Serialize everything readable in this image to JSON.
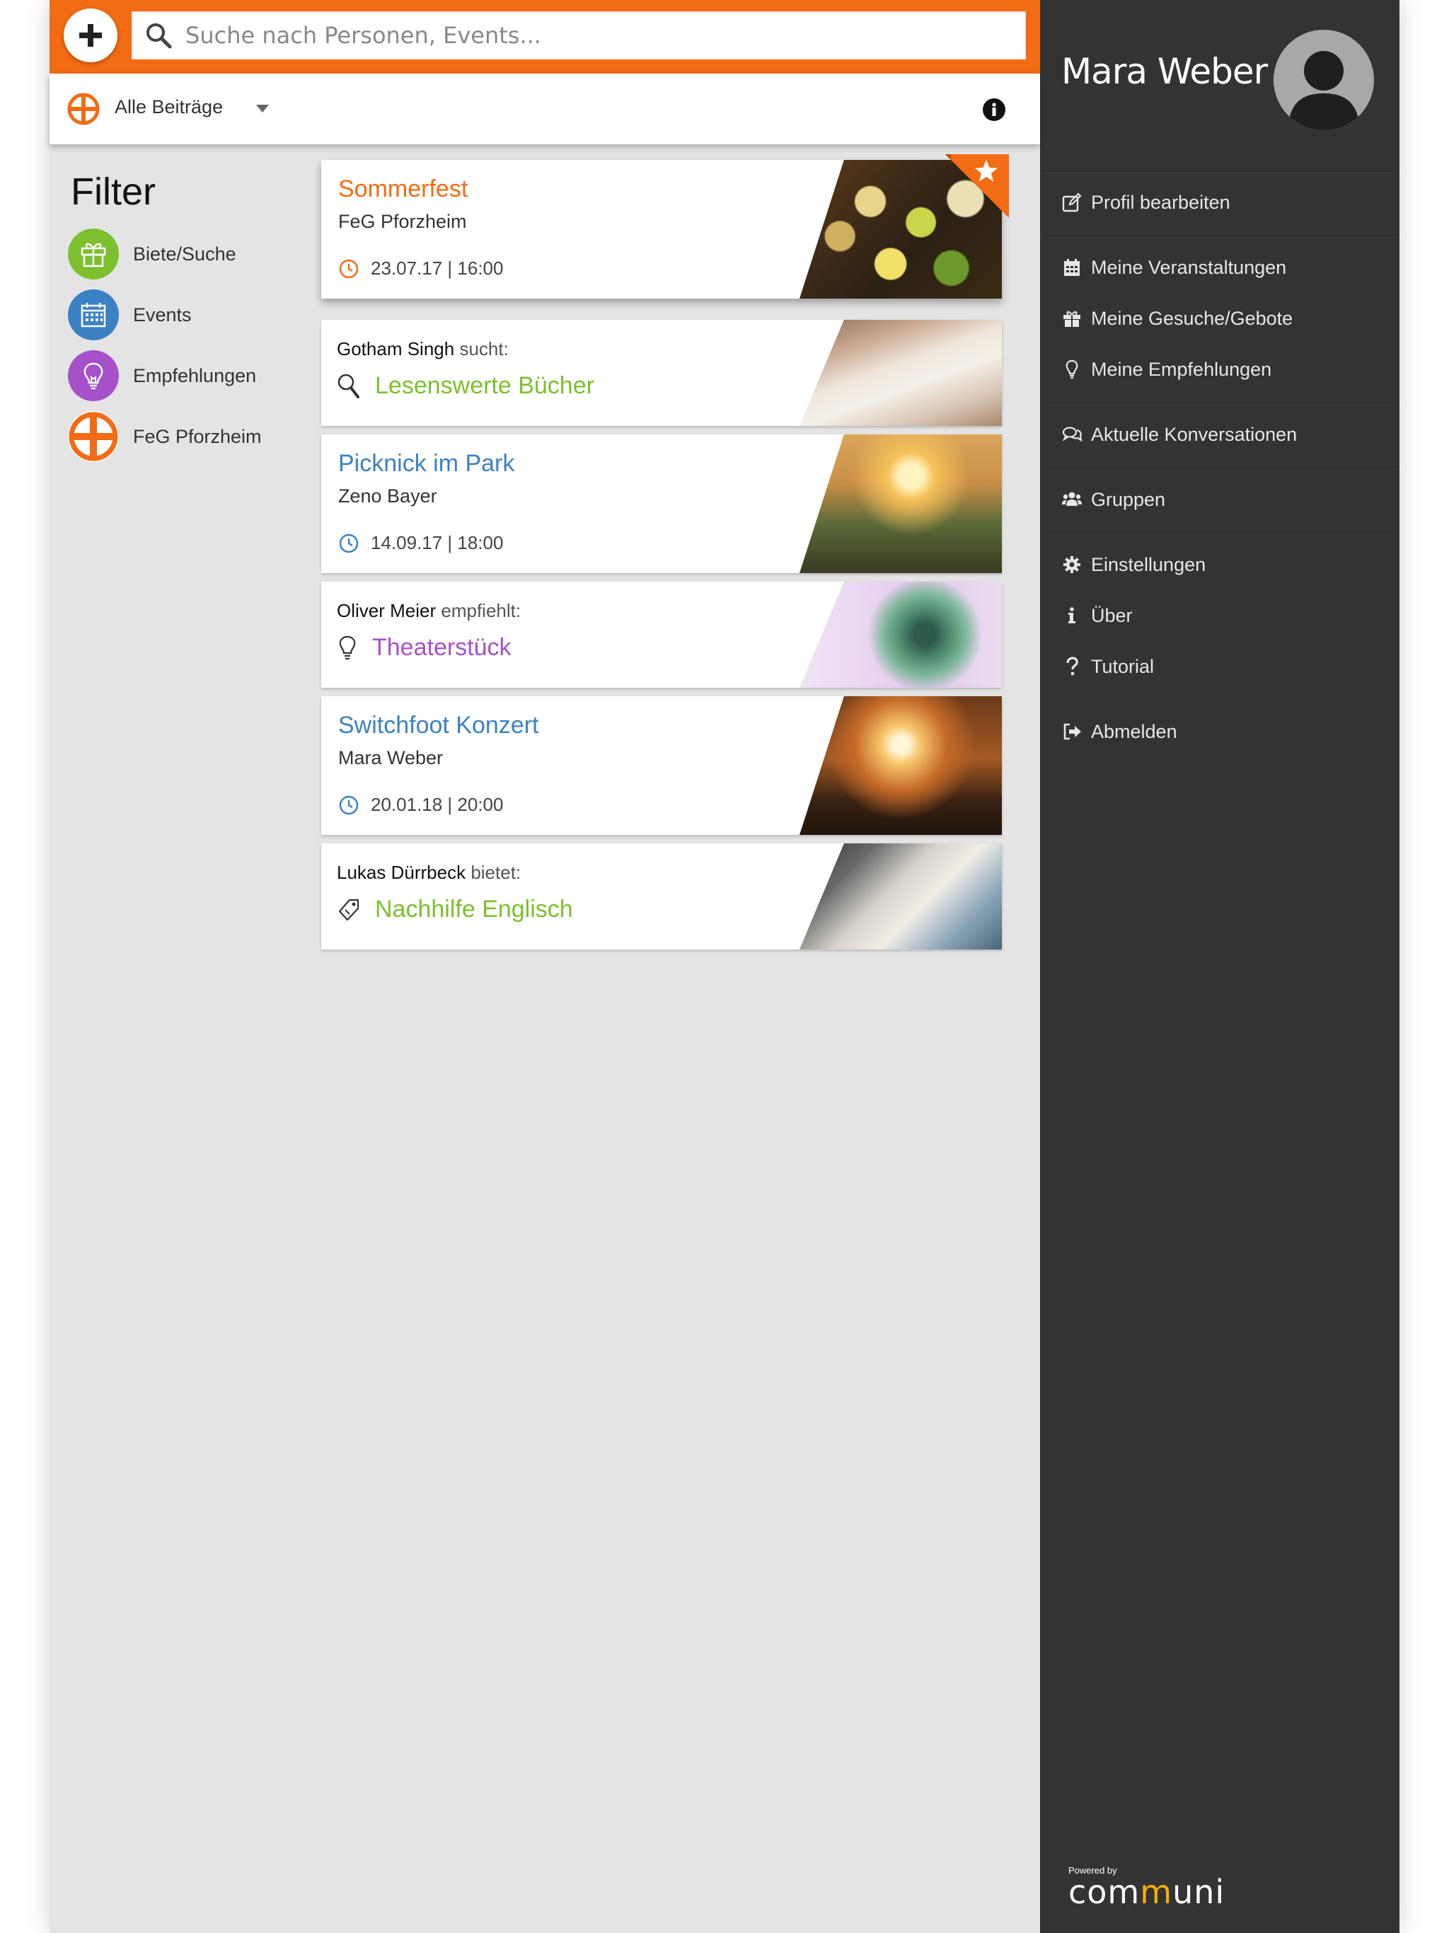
{
  "topbar": {
    "search_placeholder": "Suche nach Personen, Events..."
  },
  "select": {
    "current": "Alle Beiträge"
  },
  "filter": {
    "title": "Filter",
    "items": [
      {
        "label": "Biete/Suche",
        "color": "#7dbf2e",
        "icon": "gift-icon"
      },
      {
        "label": "Events",
        "color": "#3b82c4",
        "icon": "calendar-icon"
      },
      {
        "label": "Empfehlungen",
        "color": "#a651c9",
        "icon": "lightbulb-icon"
      },
      {
        "label": "FeG Pforzheim",
        "color": "#f36b12",
        "icon": "feg-logo-icon"
      }
    ]
  },
  "feed": [
    {
      "type": "event",
      "title": "Sommerfest",
      "subtitle": "FeG Pforzheim",
      "datetime": "23.07.17 | 16:00",
      "color": "#f36b12",
      "starred": true
    },
    {
      "type": "search",
      "person": "Gotham Singh",
      "verb": "sucht:",
      "title": "Lesenswerte Bücher",
      "color": "#7dbf2e"
    },
    {
      "type": "event",
      "title": "Picknick im Park",
      "subtitle": "Zeno Bayer",
      "datetime": "14.09.17 | 18:00",
      "color": "#3b82c4"
    },
    {
      "type": "recommendation",
      "person": "Oliver Meier",
      "verb": "empfiehlt:",
      "title": "Theaterstück",
      "color": "#a651c9"
    },
    {
      "type": "event",
      "title": "Switchfoot Konzert",
      "subtitle": "Mara Weber",
      "datetime": "20.01.18 | 20:00",
      "color": "#3b82c4"
    },
    {
      "type": "offer",
      "person": "Lukas Dürrbeck",
      "verb": "bietet:",
      "title": "Nachhilfe Englisch",
      "color": "#7dbf2e"
    }
  ],
  "sidebar": {
    "user_name": "Mara Weber",
    "menu": [
      {
        "label": "Profil bearbeiten",
        "icon": "edit-icon"
      },
      {
        "label": "Meine Veranstaltungen",
        "icon": "calendar-icon"
      },
      {
        "label": "Meine Gesuche/Gebote",
        "icon": "gift-icon"
      },
      {
        "label": "Meine Empfehlungen",
        "icon": "lightbulb-icon"
      },
      {
        "label": "Aktuelle Konversationen",
        "icon": "chat-icon"
      },
      {
        "label": "Gruppen",
        "icon": "users-icon"
      },
      {
        "label": "Einstellungen",
        "icon": "gear-icon"
      },
      {
        "label": "Über",
        "icon": "info-icon"
      },
      {
        "label": "Tutorial",
        "icon": "question-icon"
      },
      {
        "label": "Abmelden",
        "icon": "sign-out-icon"
      }
    ],
    "powered_by": "Powered by",
    "brand": {
      "pre": "com",
      "accent": "m",
      "post": "uni"
    }
  }
}
